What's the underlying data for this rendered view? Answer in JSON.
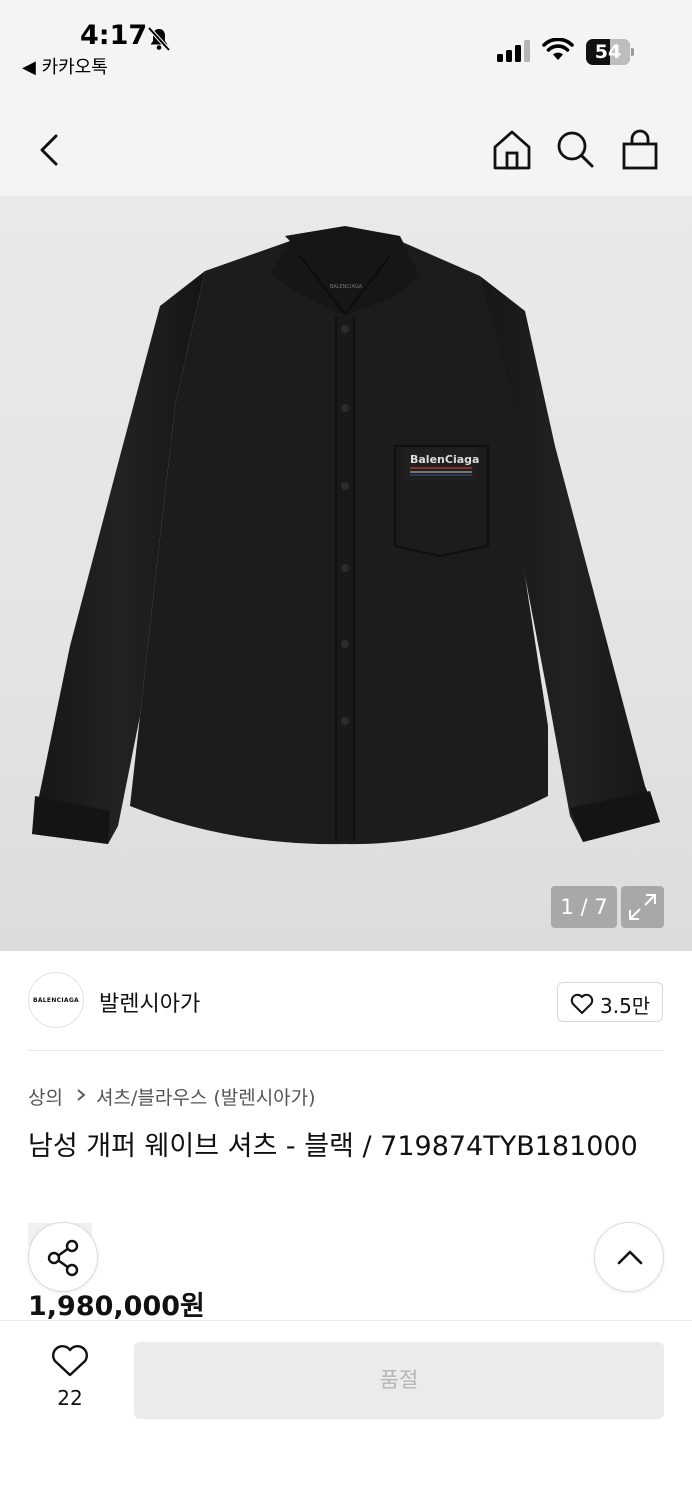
{
  "status_bar": {
    "time": "4:17",
    "back_app": "◀ 카카오톡",
    "battery": "54",
    "battery_level_percent": 54
  },
  "nav": {
    "icons": [
      "back-icon",
      "home-icon",
      "search-icon",
      "shopping-bag-icon"
    ]
  },
  "gallery": {
    "counter": "1 / 7",
    "shirt_color": "#1b1b1b",
    "pocket_logo": "BalenCiaga",
    "collar_label": "BALENCIAGA"
  },
  "brand": {
    "logo_text": "BALENCIAGA",
    "name": "발렌시아가",
    "like_count": "3.5만"
  },
  "breadcrumb": {
    "level1": "상의",
    "level2": "셔츠/블라우스 (발렌시아가)"
  },
  "product": {
    "title": "남성 개퍼 웨이브 셔츠 - 블랙 / 719874TYB181000",
    "price": "1,980,000원"
  },
  "bottom_bar": {
    "wish_count": "22",
    "soldout_label": "품절"
  },
  "colors": {
    "header_bg": "#f4f4f4",
    "soldout_bg": "#ebebeb",
    "soldout_text": "#b5b5b5"
  }
}
